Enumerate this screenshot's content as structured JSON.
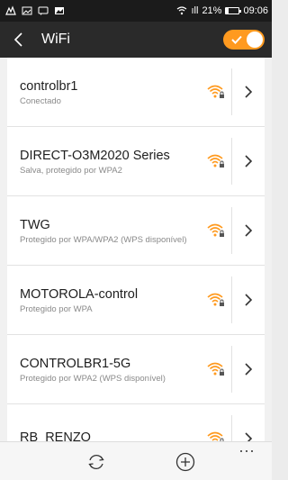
{
  "status_bar": {
    "signal_text": "ıll",
    "battery_percent": "21%",
    "battery_level": 0.21,
    "time": "09:06"
  },
  "header": {
    "title": "WiFi",
    "wifi_enabled": true
  },
  "networks": [
    {
      "name": "controlbr1",
      "status": "Conectado"
    },
    {
      "name": "DIRECT-O3M2020 Series",
      "status": "Salva, protegido por WPA2"
    },
    {
      "name": "TWG",
      "status": "Protegido por WPA/WPA2 (WPS disponível)"
    },
    {
      "name": "MOTOROLA-control",
      "status": "Protegido por WPA"
    },
    {
      "name": "CONTROLBR1-5G",
      "status": "Protegido por WPA2 (WPS disponível)"
    },
    {
      "name": "RB_RENZO",
      "status": ""
    }
  ],
  "bottom_bar": {
    "more_label": "···"
  },
  "colors": {
    "accent": "#ff9a1f",
    "header_bg": "#2a2a2a",
    "status_bg": "#1b1b1b"
  },
  "icons": {
    "back": "back-arrow-icon",
    "wifi": "wifi-locked-icon",
    "chevron": "chevron-right-icon",
    "refresh": "refresh-icon",
    "add": "add-circle-icon",
    "more": "more-icon"
  }
}
